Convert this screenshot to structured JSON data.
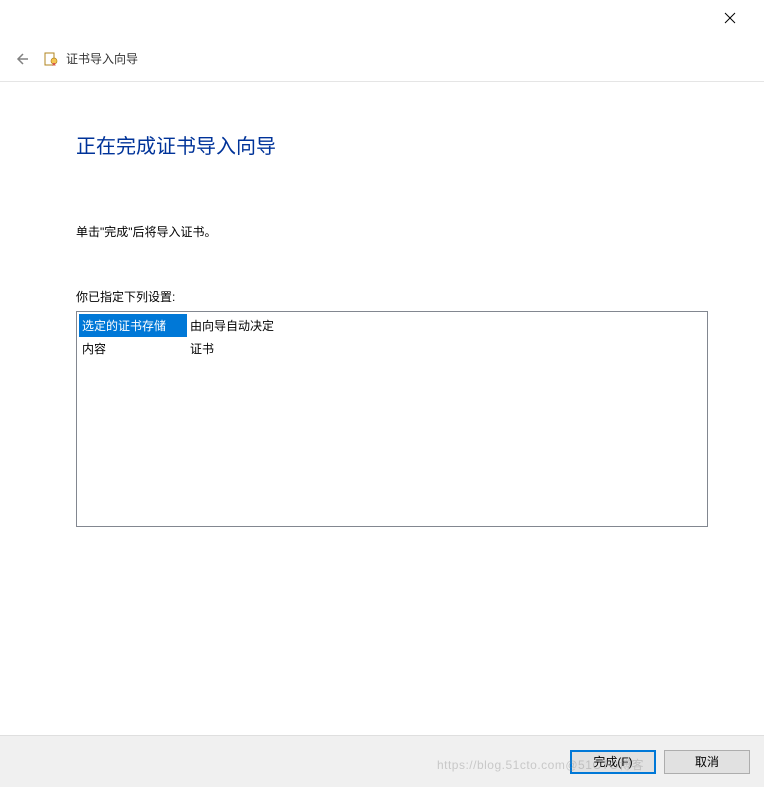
{
  "header": {
    "title": "证书导入向导"
  },
  "main": {
    "heading": "正在完成证书导入向导",
    "instruction": "单击\"完成\"后将导入证书。",
    "settings_label": "你已指定下列设置:",
    "settings_rows": [
      {
        "left": "选定的证书存储",
        "right": "由向导自动决定",
        "selected": true
      },
      {
        "left": "内容",
        "right": "证书",
        "selected": false
      }
    ]
  },
  "footer": {
    "finish_label": "完成(F)",
    "cancel_label": "取消"
  },
  "watermark": "https://blog.51cto.com@51CTO博客"
}
